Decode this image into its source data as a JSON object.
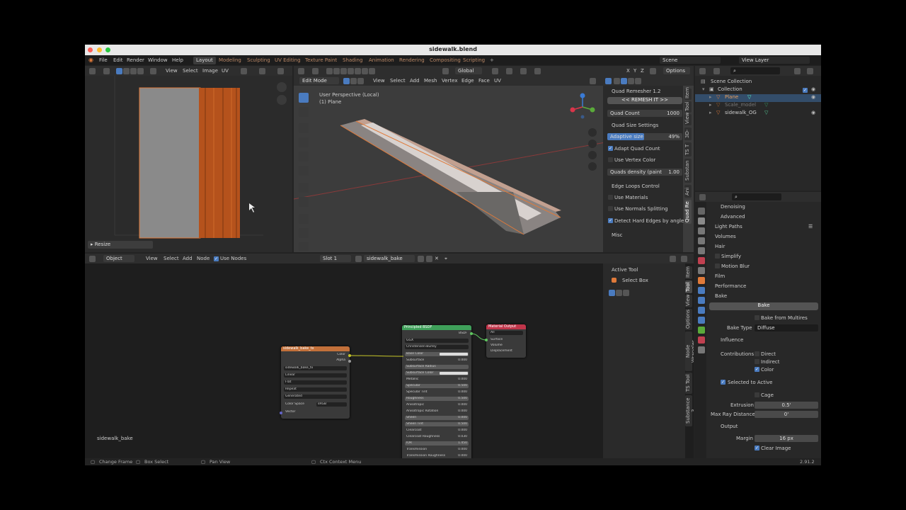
{
  "window": {
    "title": "sidewalk.blend"
  },
  "menu": [
    "File",
    "Edit",
    "Render",
    "Window",
    "Help"
  ],
  "workspaces": [
    "Layout",
    "Modeling",
    "Sculpting",
    "UV Editing",
    "Texture Paint",
    "Shading",
    "Animation",
    "Rendering",
    "Compositing",
    "Scripting"
  ],
  "scene": "Scene",
  "view_layer": "View Layer",
  "uv_editor": {
    "menus": [
      "View",
      "Select",
      "Image",
      "UV"
    ],
    "resize_label": "Resize"
  },
  "viewport": {
    "mode": "Edit Mode",
    "menus": [
      "View",
      "Select",
      "Add",
      "Mesh",
      "Vertex",
      "Edge",
      "Face",
      "UV"
    ],
    "orientation": "Global",
    "axes": [
      "X",
      "Y",
      "Z"
    ],
    "options": "Options",
    "view_name": "User Perspective (Local)",
    "object_name": "(1) Plane"
  },
  "quad_remesher": {
    "title": "Quad Remesher 1.2",
    "remesh_button": "<<  REMESH IT >>",
    "quad_count_label": "Quad Count",
    "quad_count_value": "1000",
    "quad_size_settings": "Quad Size Settings",
    "adaptive_size_label": "Adaptive size",
    "adaptive_size_value": "49%",
    "adaptive_size_fraction": 0.49,
    "adapt_quad_count": "Adapt Quad Count",
    "use_vertex_color": "Use Vertex Color",
    "quads_density_label": "Quads density (paint",
    "quads_density_value": "1.00",
    "edge_loops_control": "Edge Loops Control",
    "use_materials": "Use Materials",
    "use_normals_splitting": "Use Normals Splitting",
    "detect_hard_edges": "Detect Hard Edges by angle",
    "misc": "Misc"
  },
  "viewport_tabs": [
    "Item",
    "Tool",
    "View",
    "3D-",
    "TS T",
    "Substan",
    "Ani",
    "Quad Re"
  ],
  "outliner": {
    "title": "Scene Collection",
    "items": [
      {
        "label": "Collection"
      },
      {
        "label": "Plane"
      },
      {
        "label": "Scale_model"
      },
      {
        "label": "sidewalk_OG"
      }
    ]
  },
  "properties": {
    "denoising": "Denoising",
    "advanced": "Advanced",
    "light_paths": "Light Paths",
    "volumes": "Volumes",
    "hair": "Hair",
    "simplify": "Simplify",
    "motion_blur": "Motion Blur",
    "film": "Film",
    "performance": "Performance",
    "bake": "Bake",
    "bake_button": "Bake",
    "bake_from_multires": "Bake from Multires",
    "bake_type_label": "Bake Type",
    "bake_type_value": "Diffuse",
    "influence": "Influence",
    "contributions": "Contributions",
    "direct": "Direct",
    "indirect": "Indirect",
    "color": "Color",
    "selected_to_active": "Selected to Active",
    "cage": "Cage",
    "extrusion_label": "Extrusion",
    "extrusion_value": "0.5'",
    "max_ray_label": "Max Ray Distance",
    "max_ray_value": "0'",
    "output": "Output",
    "margin_label": "Margin",
    "margin_value": "16 px",
    "clear_image": "Clear Image"
  },
  "node_editor": {
    "mode": "Object",
    "menus": [
      "View",
      "Select",
      "Add",
      "Node"
    ],
    "use_nodes": "Use Nodes",
    "slot": "Slot 1",
    "material": "sidewalk_bake",
    "tree_name": "sidewalk_bake",
    "active_tool": "Active Tool",
    "select_box": "Select Box",
    "tabs": [
      "Item",
      "Tool",
      "View",
      "Options",
      "Node Wrangler",
      "TS Tool",
      "Substance 3"
    ],
    "image_node": {
      "title": "sidewalk_bake_tx",
      "outputs": [
        "Color",
        "Alpha"
      ],
      "image": "sidewalk_bake_tx",
      "options": [
        "Linear",
        "Flat",
        "Repeat",
        "Generated"
      ],
      "color_space_label": "Color Space",
      "color_space_value": "sRGB",
      "vector": "Vector"
    },
    "bsdf_node": {
      "title": "Principled BSDF",
      "output": "BSDF",
      "distribution": "GGX",
      "subsurface_method": "Christensen-Burley",
      "rows": [
        {
          "label": "Base Color",
          "value": ""
        },
        {
          "label": "Subsurface",
          "value": "0.000"
        },
        {
          "label": "Subsurface Radius",
          "value": ""
        },
        {
          "label": "Subsurface Color",
          "value": ""
        },
        {
          "label": "Metallic",
          "value": "0.000"
        },
        {
          "label": "Specular",
          "value": "0.500"
        },
        {
          "label": "Specular Tint",
          "value": "0.000"
        },
        {
          "label": "Roughness",
          "value": "0.500"
        },
        {
          "label": "Anisotropic",
          "value": "0.000"
        },
        {
          "label": "Anisotropic Rotation",
          "value": "0.000"
        },
        {
          "label": "Sheen",
          "value": "0.000"
        },
        {
          "label": "Sheen Tint",
          "value": "0.500"
        },
        {
          "label": "Clearcoat",
          "value": "0.000"
        },
        {
          "label": "Clearcoat Roughness",
          "value": "0.030"
        },
        {
          "label": "IOR",
          "value": "1.450"
        },
        {
          "label": "Transmission",
          "value": "0.000"
        },
        {
          "label": "Transmission Roughness",
          "value": "0.000"
        },
        {
          "label": "Emission",
          "value": ""
        },
        {
          "label": "Emission Strength",
          "value": "1.000"
        },
        {
          "label": "Alpha",
          "value": "1.000"
        },
        {
          "label": "Normal",
          "value": ""
        },
        {
          "label": "Clearcoat Normal",
          "value": ""
        },
        {
          "label": "Tangent",
          "value": ""
        }
      ]
    },
    "output_node": {
      "title": "Material Output",
      "target": "All",
      "inputs": [
        "Surface",
        "Volume",
        "Displacement"
      ]
    }
  },
  "status_bar": {
    "items": [
      "Change Frame",
      "Box Select",
      "Pan View",
      "Ctx Context Menu"
    ],
    "version": "2.91.2"
  },
  "colors": {
    "blender_orange": "#e07a3a",
    "select_blue": "#4a7bbf",
    "bsdf_header": "#3fa05a",
    "output_header": "#c0354a",
    "image_header": "#c2703a"
  }
}
